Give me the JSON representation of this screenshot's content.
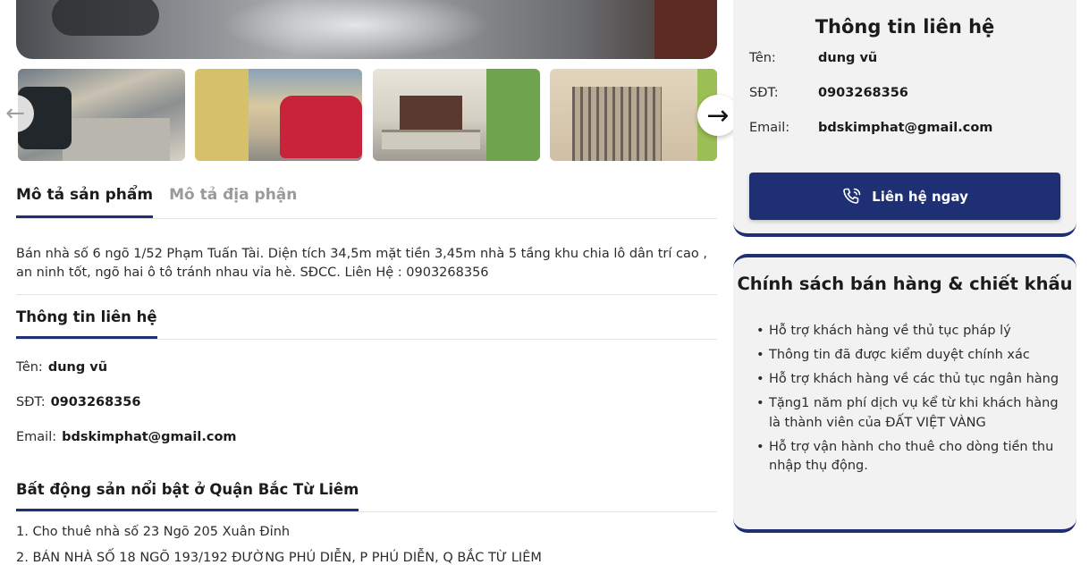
{
  "gallery": {
    "prev_icon": "arrow-left-icon",
    "next_icon": "arrow-right-icon",
    "prev_glyph": "←",
    "next_glyph": "→"
  },
  "tabs": [
    {
      "label": "Mô tả sản phẩm",
      "active": true
    },
    {
      "label": "Mô tả địa phận",
      "active": false
    }
  ],
  "description": "Bán nhà số 6 ngõ 1/52 Phạm Tuấn Tài. Diện tích 34,5m mặt tiền 3,45m nhà 5 tầng khu chia lô dân trí cao , an ninh tốt, ngõ hai ô tô tránh nhau vỉa hè. SĐCC. Liên Hệ : 0903268356",
  "contact_section": {
    "title": "Thông tin liên hệ",
    "name_label": "Tên:",
    "name_value": "dung vũ",
    "phone_label": "SĐT:",
    "phone_value": "0903268356",
    "email_label": "Email:",
    "email_value": "bdskimphat@gmail.com"
  },
  "featured": {
    "title": "Bất động sản nổi bật ở Quận Bắc Từ Liêm",
    "items": [
      "1. Cho thuê nhà số 23 Ngõ 205 Xuân Đỉnh",
      "2. BÁN NHÀ SỐ 18 NGÕ 193/192 ĐƯỜNG PHÚ DIỄN, P PHÚ DIỄN, Q BẮC TỪ LIÊM"
    ]
  },
  "contact_card": {
    "title": "Thông tin liên hệ",
    "name_label": "Tên:",
    "name_value": "dung vũ",
    "phone_label": "SĐT:",
    "phone_value": "0903268356",
    "email_label": "Email:",
    "email_value": "bdskimphat@gmail.com",
    "cta_label": "Liên hệ ngay",
    "cta_icon": "phone-icon"
  },
  "policy_card": {
    "title": "Chính sách bán hàng & chiết khấu",
    "items": [
      "Hỗ trợ khách hàng về thủ tục pháp lý",
      "Thông tin đã được kiểm duyệt chính xác",
      "Hỗ trợ khách hàng về các thủ tục ngân hàng",
      "Tặng1 năm phí dịch vụ kể từ khi khách hàng là thành viên của ĐẤT VIỆT VÀNG",
      "Hỗ trợ vận hành cho thuê cho dòng tiền thu nhập thụ động."
    ]
  },
  "colors": {
    "accent": "#1e2f73",
    "card_bg": "#f2f2f3"
  }
}
